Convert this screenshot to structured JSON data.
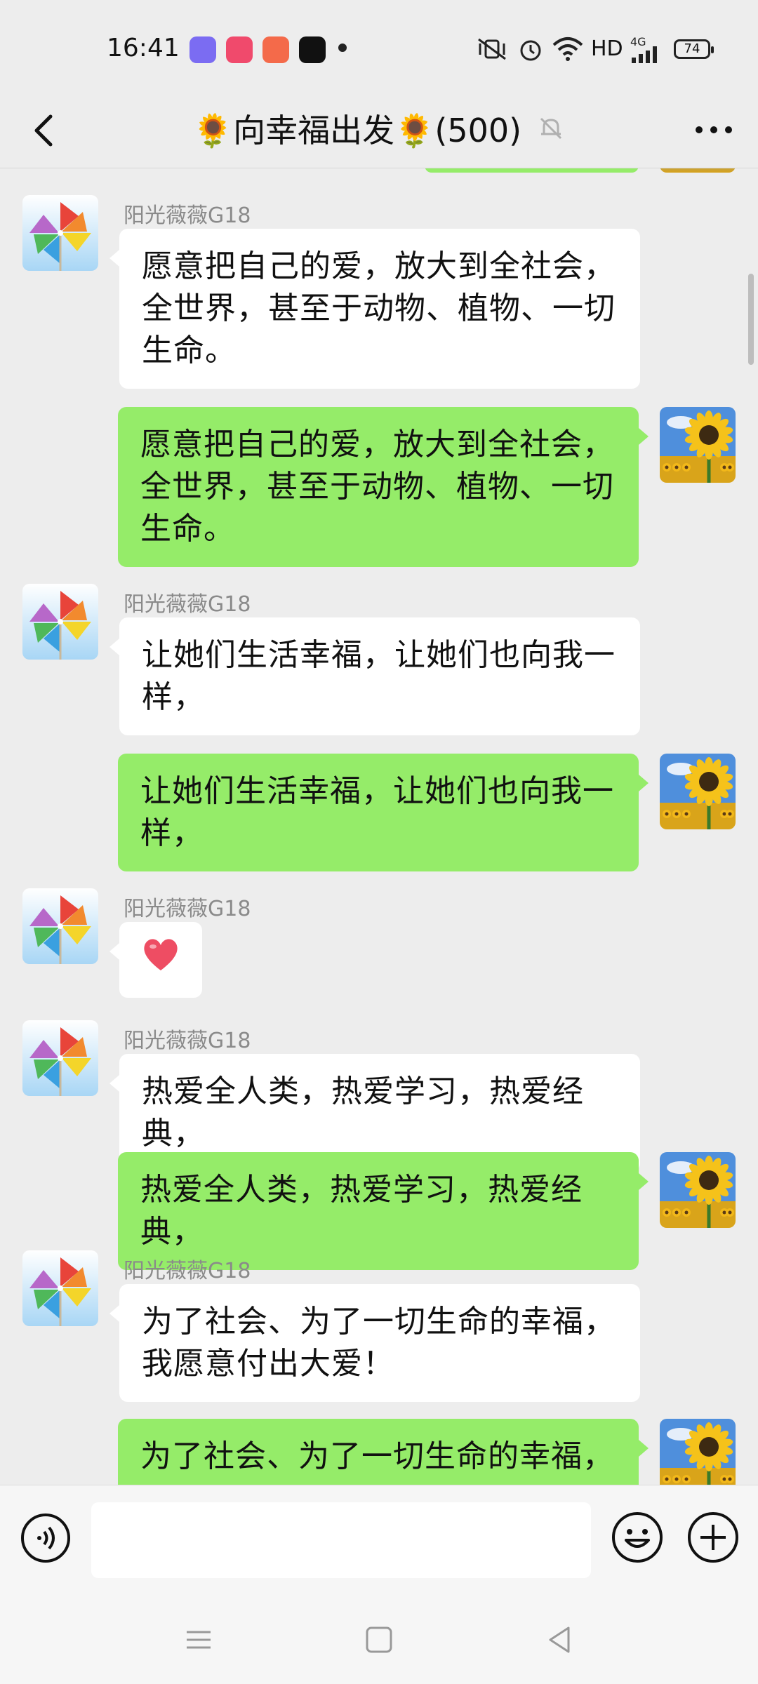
{
  "status_bar": {
    "time": "16:41",
    "network": "HD",
    "signal_label": "4G",
    "battery": "74"
  },
  "header": {
    "title": "🌻向幸福出发🌻(500)",
    "icons": {
      "back": "chevron-left-icon",
      "mute": "bell-off-icon",
      "more": "more-dots-icon"
    }
  },
  "chat": {
    "messages": [
      {
        "side": "left",
        "sender": "阳光薇薇G18",
        "text": "愿意把自己的爱，放大到全社会，全世界，甚至于动物、植物、一切生命。"
      },
      {
        "side": "right",
        "text": "愿意把自己的爱，放大到全社会，全世界，甚至于动物、植物、一切生命。"
      },
      {
        "side": "left",
        "sender": "阳光薇薇G18",
        "text": "让她们生活幸福，让她们也向我一样，"
      },
      {
        "side": "right",
        "text": "让她们生活幸福，让她们也向我一样，"
      },
      {
        "side": "left",
        "sender": "阳光薇薇G18",
        "text": "❤️",
        "type": "emoji-heart"
      },
      {
        "side": "left",
        "sender": "阳光薇薇G18",
        "text": "热爱全人类，热爱学习，热爱经典，"
      },
      {
        "side": "right",
        "text": "热爱全人类，热爱学习，热爱经典，"
      },
      {
        "side": "left",
        "sender": "阳光薇薇G18",
        "text": "为了社会、为了一切生命的幸福，我愿意付出大爱！"
      },
      {
        "side": "right",
        "text": "为了社会、为了一切生命的幸福，"
      }
    ]
  },
  "input_bar": {
    "placeholder": "",
    "icons": {
      "voice": "voice-icon",
      "emoji": "emoji-icon",
      "plus": "plus-icon"
    }
  },
  "nav_bar": {
    "icons": [
      "menu-icon",
      "home-icon",
      "back-triangle-icon"
    ]
  },
  "colors": {
    "background": "#ededed",
    "bubble_self": "#95ec69",
    "bubble_other": "#ffffff"
  }
}
